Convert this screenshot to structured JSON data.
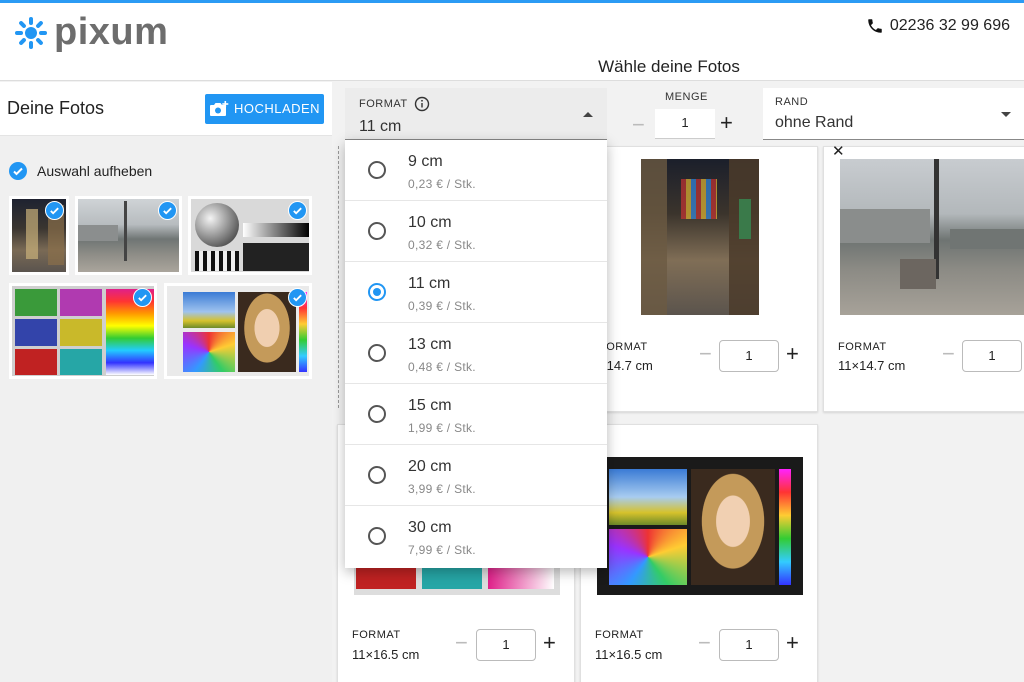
{
  "header": {
    "brand": "pixum",
    "phone": "02236 32 99 696",
    "subtitle": "Wähle deine Fotos"
  },
  "left_panel": {
    "title": "Deine Fotos",
    "upload_label": "HOCHLADEN",
    "deselect_label": "Auswahl aufheben"
  },
  "controls": {
    "format_label": "FORMAT",
    "format_value": "11 cm",
    "menge_label": "MENGE",
    "menge_value": "1",
    "rand_label": "RAND",
    "rand_value": "ohne Rand"
  },
  "format_options": [
    {
      "size": "9 cm",
      "price": "0,23 € / Stk.",
      "selected": false
    },
    {
      "size": "10 cm",
      "price": "0,32 € / Stk.",
      "selected": false
    },
    {
      "size": "11 cm",
      "price": "0,39 € / Stk.",
      "selected": true
    },
    {
      "size": "13 cm",
      "price": "0,48 € / Stk.",
      "selected": false
    },
    {
      "size": "15 cm",
      "price": "1,99 € / Stk.",
      "selected": false
    },
    {
      "size": "20 cm",
      "price": "3,99 € / Stk.",
      "selected": false
    },
    {
      "size": "30 cm",
      "price": "7,99 € / Stk.",
      "selected": false
    }
  ],
  "cards": [
    {
      "format_label": "FORMAT",
      "format_value": "×14.7 cm",
      "qty": "1"
    },
    {
      "format_label": "FORMAT",
      "format_value": "11×14.7 cm",
      "qty": "1"
    },
    {
      "format_label": "FORMAT",
      "format_value": "11×16.5 cm",
      "qty": "1"
    },
    {
      "format_label": "FORMAT",
      "format_value": "11×16.5 cm",
      "qty": "1"
    }
  ],
  "colors": {
    "accent": "#2196f3",
    "top_line": "#2b9bf4"
  }
}
